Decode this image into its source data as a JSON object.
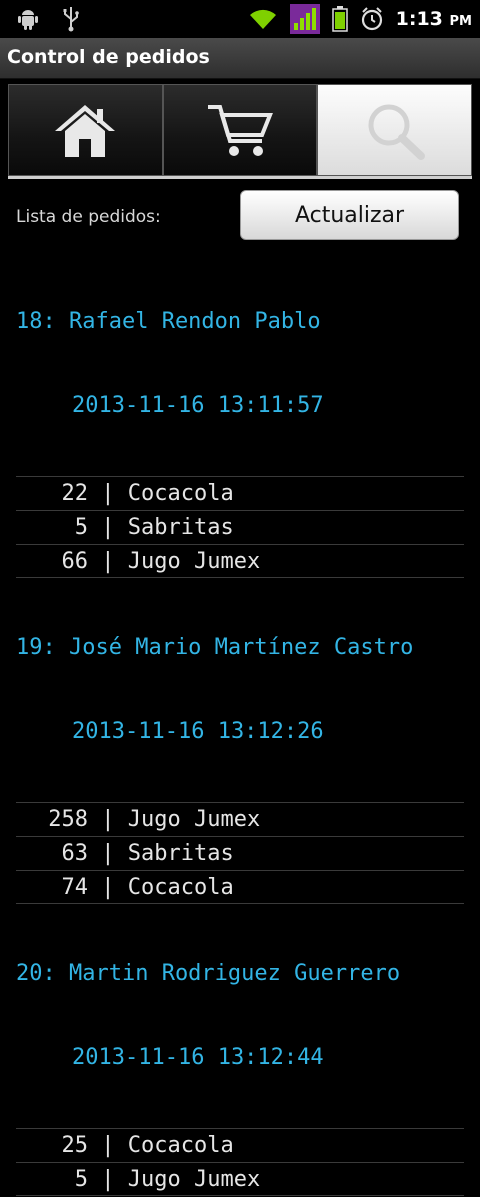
{
  "status": {
    "time": "1:13",
    "ampm": "PM"
  },
  "title": "Control de pedidos",
  "tabs": [
    {
      "name": "home",
      "icon": "home-icon",
      "active": false
    },
    {
      "name": "cart",
      "icon": "cart-icon",
      "active": false
    },
    {
      "name": "search",
      "icon": "search-icon",
      "active": true
    }
  ],
  "list_label": "Lista de pedidos:",
  "refresh_label": "Actualizar",
  "orders": [
    {
      "header": "18: Rafael Rendon Pablo",
      "date": "2013-11-16 13:11:57",
      "items": [
        {
          "qty": "22",
          "product": "Cocacola"
        },
        {
          "qty": "5",
          "product": "Sabritas"
        },
        {
          "qty": "66",
          "product": "Jugo Jumex"
        }
      ]
    },
    {
      "header": "19: José Mario Martínez Castro",
      "date": "2013-11-16 13:12:26",
      "items": [
        {
          "qty": "258",
          "product": "Jugo Jumex"
        },
        {
          "qty": "63",
          "product": "Sabritas"
        },
        {
          "qty": "74",
          "product": "Cocacola"
        }
      ]
    },
    {
      "header": "20: Martin Rodriguez Guerrero",
      "date": "2013-11-16 13:12:44",
      "items": [
        {
          "qty": "25",
          "product": "Cocacola"
        },
        {
          "qty": "5",
          "product": "Jugo Jumex"
        }
      ]
    }
  ]
}
